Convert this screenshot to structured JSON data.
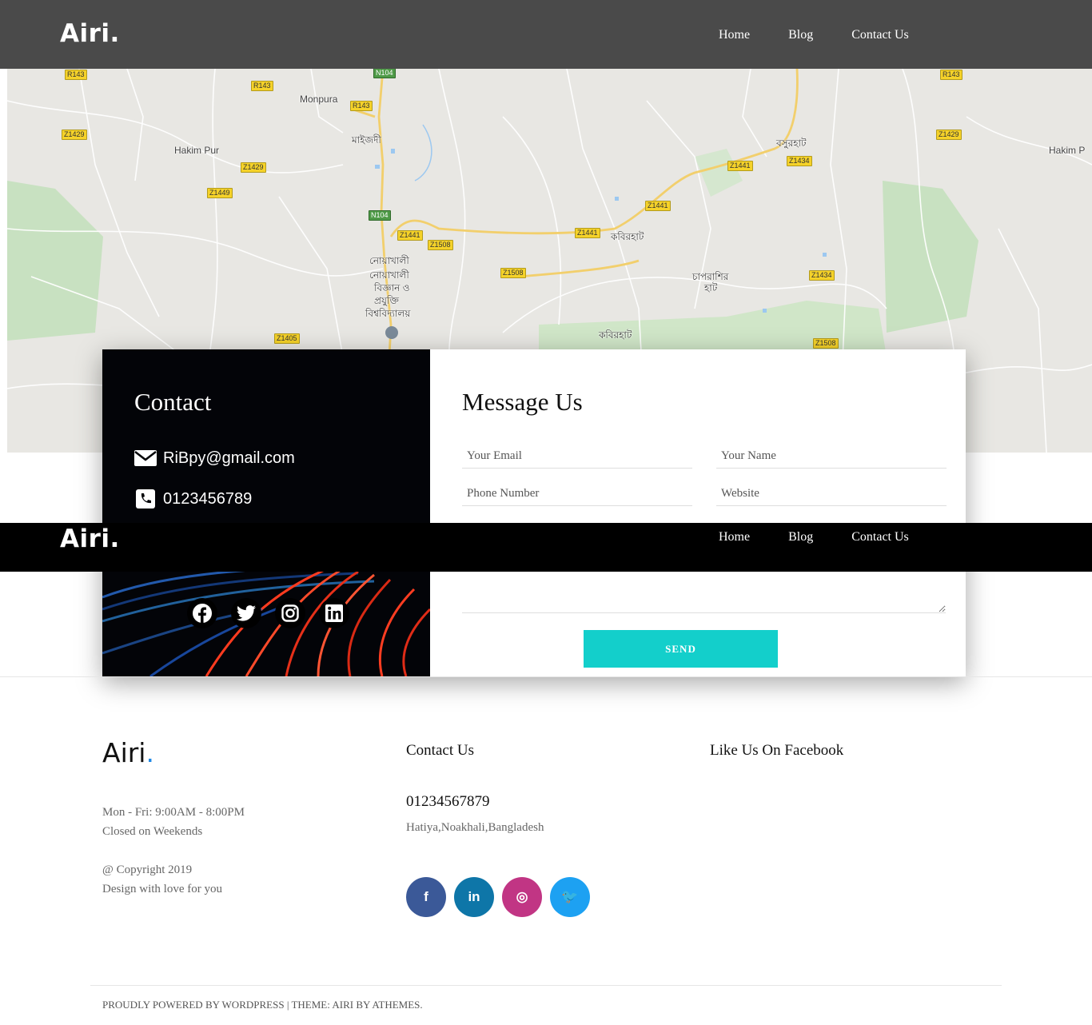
{
  "header": {
    "logo": "Airi.",
    "nav": [
      {
        "label": "Home"
      },
      {
        "label": "Blog"
      },
      {
        "label": "Contact Us"
      }
    ]
  },
  "map": {
    "places": [
      "Monpura",
      "মাইজদী",
      "Hakim Pur",
      "নোয়াখালী",
      "নোয়াখালী",
      "বিজ্ঞান ও",
      "প্রযুক্তি",
      "বিশ্ববিদ্যালয়",
      "বসুরহাট",
      "কবিরহাট",
      "চাপরাশির",
      "হাট",
      "কবিরহাট",
      "Hakim P"
    ],
    "routes": [
      "R143",
      "R143",
      "R143",
      "N104",
      "Z1429",
      "Z1429",
      "Z1449",
      "N104",
      "Z1441",
      "Z1508",
      "Z1441",
      "Z1441",
      "Z1441",
      "Z1434",
      "Z1508",
      "Z1434",
      "Z1405",
      "Z1508",
      "Z1429",
      "R143"
    ]
  },
  "contact": {
    "title": "Contact",
    "email": "RiBpy@gmail.com",
    "phone": "0123456789",
    "socials": [
      "facebook-icon",
      "twitter-icon",
      "instagram-icon",
      "linkedin-icon"
    ]
  },
  "form": {
    "title": "Message Us",
    "email_placeholder": "Your Email",
    "name_placeholder": "Your Name",
    "phone_placeholder": "Phone Number",
    "website_placeholder": "Website",
    "send_label": "SEND"
  },
  "footer": {
    "logo_text": "Airi",
    "logo_dot": ".",
    "hours": "Mon - Fri: 9:00AM - 8:00PM",
    "closed": "Closed on Weekends",
    "copyright": "@ Copyright 2019",
    "design": "Design with love for you",
    "contact_heading": "Contact Us",
    "phone": "01234567879",
    "address": "Hatiya,Noakhali,Bangladesh",
    "facebook_heading": "Like Us On Facebook",
    "social": [
      {
        "name": "facebook",
        "glyph": "f",
        "color": "#3b5998"
      },
      {
        "name": "linkedin",
        "glyph": "in",
        "color": "#0e76a8"
      },
      {
        "name": "instagram",
        "glyph": "◎",
        "color": "#c13584"
      },
      {
        "name": "twitter",
        "glyph": "🐦",
        "color": "#1da1f2"
      }
    ],
    "powered": "PROUDLY POWERED BY WORDPRESS",
    "separator": "|",
    "theme": "THEME: AIRI BY ATHEMES."
  },
  "colors": {
    "header_bg": "#4a4a4a",
    "accent": "#13cfcb",
    "logo_dot": "#1e88e5"
  }
}
